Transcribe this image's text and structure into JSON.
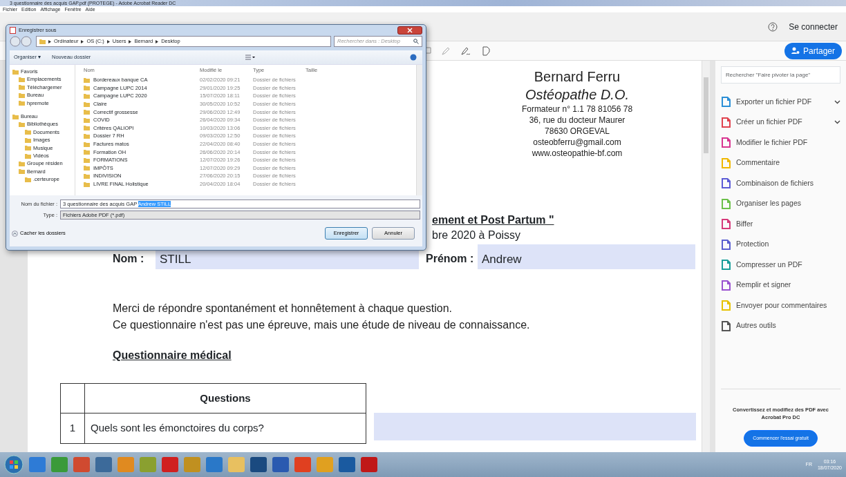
{
  "window": {
    "title": "3 questionnaire des acquis GAP.pdf (PROTEGE) - Adobe Acrobat Reader DC"
  },
  "menu": [
    "Fichier",
    "Edition",
    "Affichage",
    "Fenêtre",
    "Aide"
  ],
  "top_bar": {
    "sign_in": "Se connecter",
    "share": "Partager"
  },
  "document": {
    "header": [
      {
        "text": "Bernard Ferru",
        "kind": "name"
      },
      {
        "text": "Ostéopathe D.O.",
        "kind": "role"
      },
      {
        "text": "Formateur n° 1.1 78 81056 78",
        "kind": "line"
      },
      {
        "text": "36, rue du docteur Maurer",
        "kind": "line"
      },
      {
        "text": "78630 ORGEVAL",
        "kind": "line"
      },
      {
        "text": "osteobferru@gmail.com",
        "kind": "line"
      },
      {
        "text": "www.osteopathie-bf.com",
        "kind": "line"
      }
    ],
    "title_fragment": "ement et Post Partum \"",
    "date_fragment": "bre 2020 à Poissy",
    "fields": [
      {
        "label": "Nom :",
        "value": "STILL"
      },
      {
        "label": "Prénom :",
        "value": "Andrew"
      }
    ],
    "intro": [
      "Merci de répondre spontanément et honnêtement à chaque question.",
      "Ce questionnaire n'est pas une épreuve, mais une étude de niveau de connaissance."
    ],
    "section": "Questionnaire médical",
    "table": {
      "header": "Questions",
      "rows": [
        {
          "number": "1",
          "question": "Quels sont les émonctoires du corps?"
        }
      ]
    }
  },
  "tools_panel": {
    "search": {
      "placeholder": "Rechercher \"Faire pivoter la page\""
    },
    "tools": [
      {
        "label": "Exporter un fichier PDF",
        "expandable": true,
        "color": "#2b8fd6"
      },
      {
        "label": "Créer un fichier PDF",
        "expandable": true,
        "color": "#e0424e"
      },
      {
        "label": "Modifier le fichier PDF",
        "expandable": false,
        "color": "#d8358f"
      },
      {
        "label": "Commentaire",
        "expandable": false,
        "color": "#f0b800"
      },
      {
        "label": "Combinaison de fichiers",
        "expandable": false,
        "color": "#5b5bd6"
      },
      {
        "label": "Organiser les pages",
        "expandable": false,
        "color": "#6cc04a"
      },
      {
        "label": "Biffer",
        "expandable": false,
        "color": "#d63a7a"
      },
      {
        "label": "Protection",
        "expandable": false,
        "color": "#5a5fd0"
      },
      {
        "label": "Compresser un PDF",
        "expandable": false,
        "color": "#1a9e9a"
      },
      {
        "label": "Remplir et signer",
        "expandable": false,
        "color": "#9a52d0"
      },
      {
        "label": "Envoyer pour commentaires",
        "expandable": false,
        "color": "#e6c200"
      },
      {
        "label": "Autres outils",
        "expandable": false,
        "color": "#555555"
      }
    ],
    "promo": {
      "text": "Convertissez et modifiez des PDF avec Acrobat Pro DC",
      "button": "Commencer l'essai gratuit"
    }
  },
  "dialog": {
    "title": "Enregistrer sous",
    "path": [
      "Ordinateur",
      "OS (C:)",
      "Users",
      "Bernard",
      "Desktop"
    ],
    "search": {
      "placeholder": "Rechercher dans : Desktop"
    },
    "commands": [
      "Organiser ▾",
      "Nouveau dossier"
    ],
    "nav": [
      {
        "label": "Favoris",
        "children": [
          {
            "label": "Emplacements"
          },
          {
            "label": "Téléchargemer"
          },
          {
            "label": "Bureau"
          },
          {
            "label": "hpremote"
          }
        ]
      },
      {
        "label": "Bureau",
        "children": [
          {
            "label": "Bibliothèques",
            "children": [
              {
                "label": "Documents"
              },
              {
                "label": "Images"
              },
              {
                "label": "Musique"
              },
              {
                "label": "Vidéos"
              }
            ]
          },
          {
            "label": "Groupe résiden"
          },
          {
            "label": "Bernard",
            "children": [
              {
                "label": ".certeurope"
              }
            ]
          }
        ]
      }
    ],
    "columns": [
      "Nom",
      "Modifié le",
      "Type",
      "Taille"
    ],
    "files": [
      {
        "name": "Bordereaux banque CA",
        "modified": "02/02/2020 09:21",
        "type": "Dossier de fichiers"
      },
      {
        "name": "Campagne LUPC 2014",
        "modified": "29/01/2020 19:25",
        "type": "Dossier de fichiers"
      },
      {
        "name": "Campagne LUPC 2020",
        "modified": "15/07/2020 18:11",
        "type": "Dossier de fichiers"
      },
      {
        "name": "Claire",
        "modified": "30/05/2020 10:52",
        "type": "Dossier de fichiers"
      },
      {
        "name": "Correctif grossesse",
        "modified": "29/06/2020 12:49",
        "type": "Dossier de fichiers"
      },
      {
        "name": "COVID",
        "modified": "26/04/2020 09:34",
        "type": "Dossier de fichiers"
      },
      {
        "name": "Critères QALIOPI",
        "modified": "10/03/2020 13:06",
        "type": "Dossier de fichiers"
      },
      {
        "name": "Dossier 7 RH",
        "modified": "09/03/2020 12:50",
        "type": "Dossier de fichiers"
      },
      {
        "name": "Factures matos",
        "modified": "22/04/2020 08:40",
        "type": "Dossier de fichiers"
      },
      {
        "name": "Formation OH",
        "modified": "26/06/2020 20:14",
        "type": "Dossier de fichiers"
      },
      {
        "name": "FORMATIONS",
        "modified": "12/07/2020 19:26",
        "type": "Dossier de fichiers"
      },
      {
        "name": "IMPÔTS",
        "modified": "12/07/2020 09:29",
        "type": "Dossier de fichiers"
      },
      {
        "name": "INDIVISION",
        "modified": "27/06/2020 20:15",
        "type": "Dossier de fichiers"
      },
      {
        "name": "LIVRE FINAL Holistique",
        "modified": "20/04/2020 18:04",
        "type": "Dossier de fichiers"
      }
    ],
    "filename_label": "Nom du fichier :",
    "filename": {
      "value": "3 questionnaire des acquis GAP ",
      "selected_text": "Andrew STILL"
    },
    "type_label": "Type :",
    "type_value": "Fichiers Adobe PDF (*.pdf)",
    "hide_folders": "Cacher les dossiers",
    "buttons": [
      {
        "label": "Enregistrer",
        "default": true
      },
      {
        "label": "Annuler",
        "default": false
      }
    ]
  },
  "taskbar": {
    "language": "FR",
    "time": "03:16",
    "date": "18/07/2020"
  }
}
